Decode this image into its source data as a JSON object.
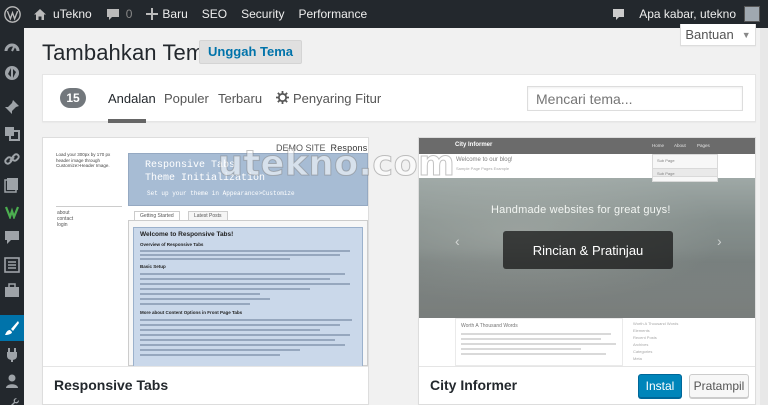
{
  "adminbar": {
    "site_name": "uTekno",
    "comments_count": "0",
    "new_label": "Baru",
    "seo_label": "SEO",
    "security_label": "Security",
    "performance_label": "Performance",
    "greeting": "Apa kabar, utekno"
  },
  "header": {
    "title": "Tambahkan Tema",
    "upload_label": "Unggah Tema",
    "help_label": "Bantuan"
  },
  "filter": {
    "count": "15",
    "tabs": [
      "Andalan",
      "Populer",
      "Terbaru"
    ],
    "feature_filter_label": "Penyaring Fitur",
    "search_placeholder": "Mencari tema..."
  },
  "themes": [
    {
      "name": "Responsive Tabs",
      "preview": {
        "demo_label": "DEMO SITE",
        "demo_title": "Responsive Tabs",
        "banner_title": "Responsive Tabs",
        "banner_subtitle": "Theme Initialization",
        "banner_tagline": "Set up your theme in Appearance>Customize",
        "side_text": "Load your 300px by 170 px header image through Customize>Header Image.",
        "side_links": [
          "about",
          "contact",
          "login"
        ],
        "tab1": "Getting Started",
        "tab2": "Latest Posts",
        "box_heading": "Welcome to Responsive Tabs!",
        "section1": "Overview of Responsive Tabs",
        "section2": "Basic Setup",
        "section3": "More about Content Options in Front Page Tabs"
      }
    },
    {
      "name": "City Informer",
      "details_label": "Rincian & Pratinjau",
      "install_label": "Instal",
      "preview_label": "Pratampil",
      "preview": {
        "logo": "City Informer",
        "nav": [
          "Home",
          "About",
          "Pages"
        ],
        "dropdown": [
          "Sub Page",
          "Sub Page"
        ],
        "greeting": "Welcome to our blog!",
        "sub": "Sample Page   Pages Example",
        "hero_text": "Handmade websites for great guys!",
        "post_title": "Worth A Thousand Words",
        "aside": [
          "Worth A Thousand Words",
          "Elements",
          "Recent Posts",
          "Archives",
          "Categories",
          "Meta"
        ]
      }
    }
  ],
  "watermark": "utekno.com",
  "colors": {
    "adminbar_bg": "#23282d",
    "accent": "#0073aa",
    "primary_button": "#0085ba"
  },
  "icons": {
    "wp": "wordpress-logo-icon",
    "home": "home-icon",
    "comments": "comment-icon",
    "new": "plus-icon"
  }
}
